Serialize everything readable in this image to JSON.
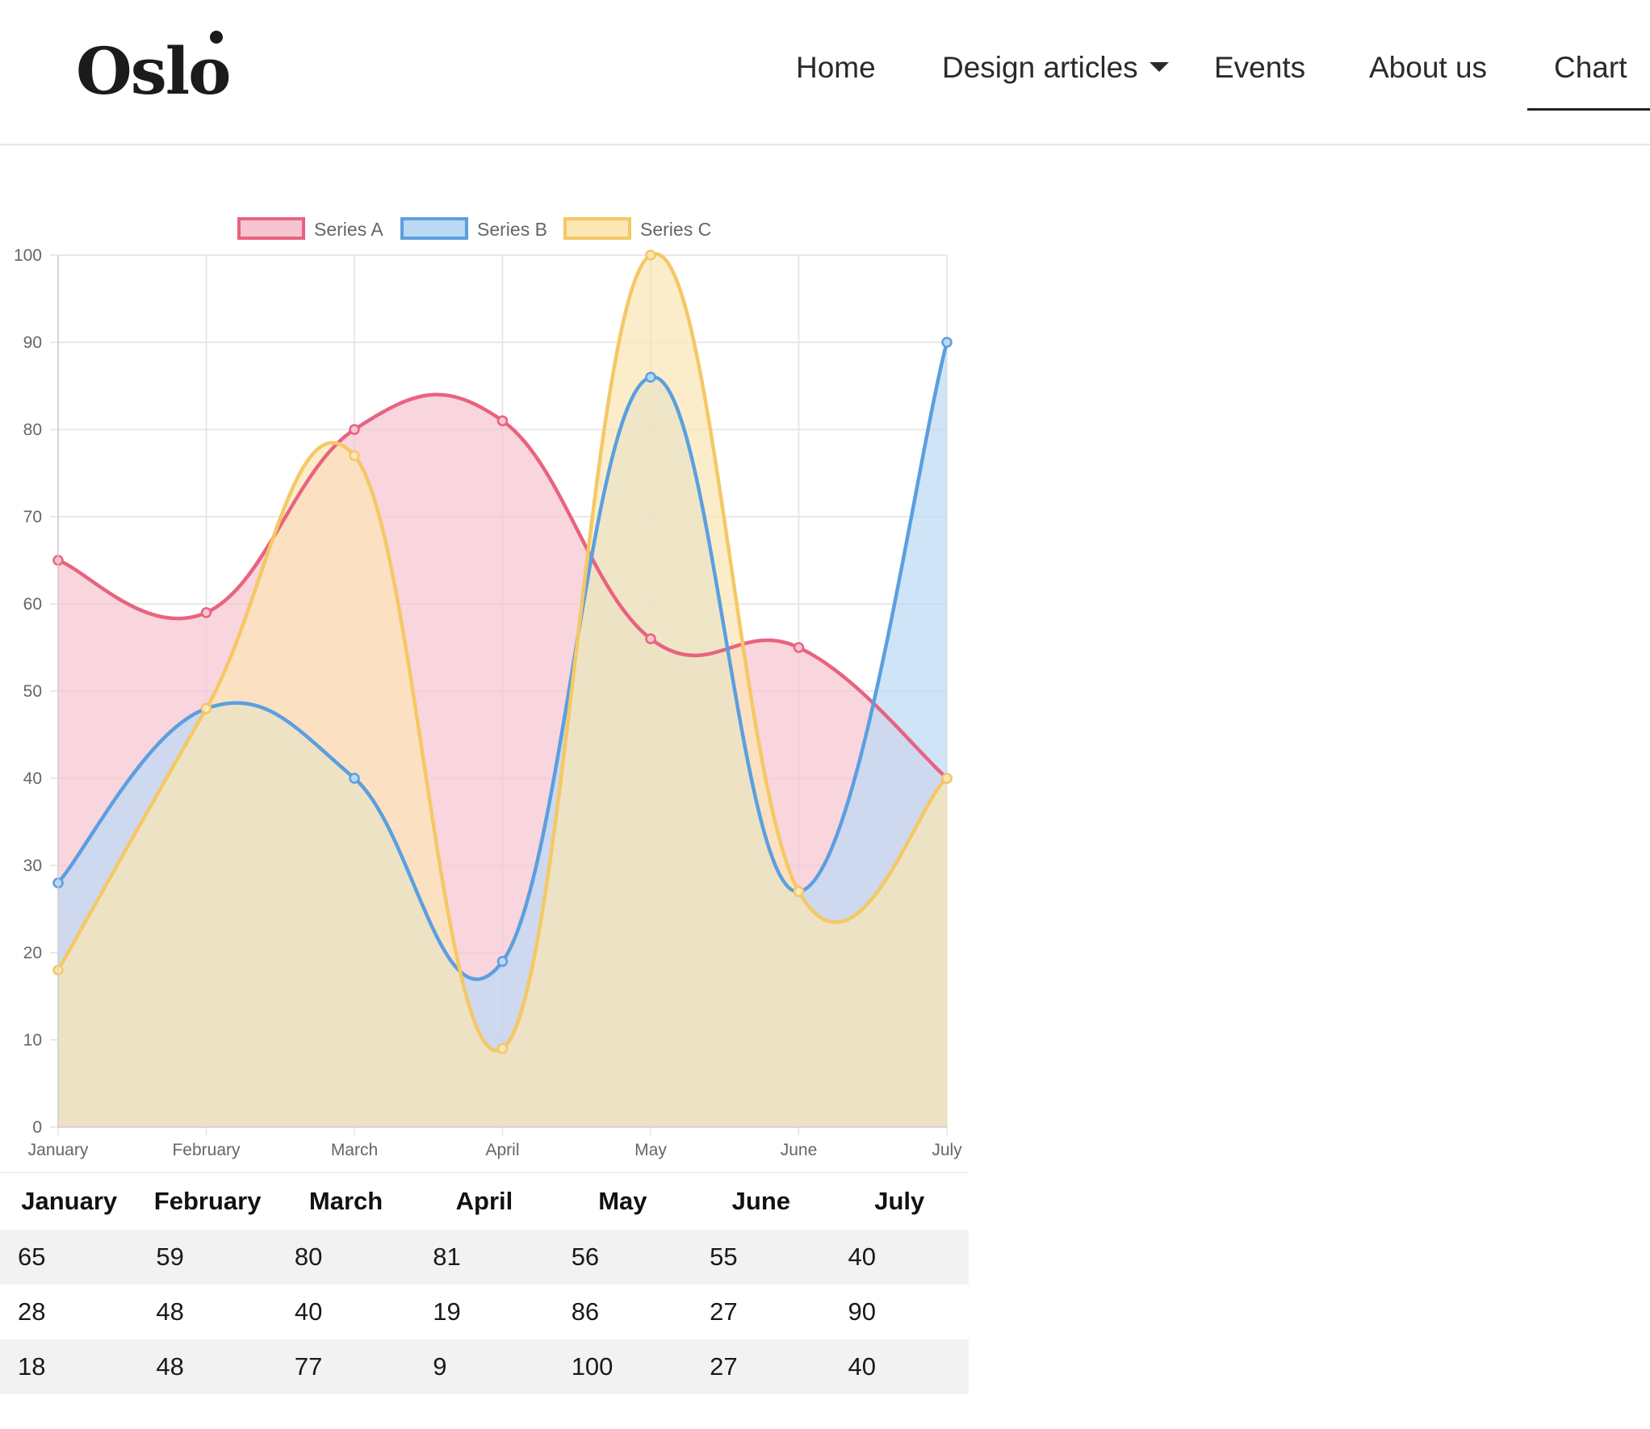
{
  "header": {
    "logo": "Oslo",
    "nav": [
      {
        "label": "Home",
        "active": false
      },
      {
        "label": "Design articles",
        "active": false,
        "has_dropdown": true
      },
      {
        "label": "Events",
        "active": false
      },
      {
        "label": "About us",
        "active": false
      },
      {
        "label": "Chart",
        "active": true
      }
    ]
  },
  "chart_data": {
    "type": "area",
    "categories": [
      "January",
      "February",
      "March",
      "April",
      "May",
      "June",
      "July"
    ],
    "series": [
      {
        "name": "Series A",
        "values": [
          65,
          59,
          80,
          81,
          56,
          55,
          40
        ],
        "color": "#e8637f",
        "fill": "#f7c5d0"
      },
      {
        "name": "Series B",
        "values": [
          28,
          48,
          40,
          19,
          86,
          27,
          90
        ],
        "color": "#5b9fe0",
        "fill": "#bcd9f4"
      },
      {
        "name": "Series C",
        "values": [
          18,
          48,
          77,
          9,
          100,
          27,
          40
        ],
        "color": "#f4c865",
        "fill": "#fbe6b5"
      }
    ],
    "ylim": [
      0,
      100
    ],
    "yticks": [
      0,
      10,
      20,
      30,
      40,
      50,
      60,
      70,
      80,
      90,
      100
    ],
    "grid": true,
    "legend_position": "top",
    "curve": "smooth"
  },
  "table": {
    "headers": [
      "January",
      "February",
      "March",
      "April",
      "May",
      "June",
      "July"
    ],
    "rows": [
      [
        "65",
        "59",
        "80",
        "81",
        "56",
        "55",
        "40"
      ],
      [
        "28",
        "48",
        "40",
        "19",
        "86",
        "27",
        "90"
      ],
      [
        "18",
        "48",
        "77",
        "9",
        "100",
        "27",
        "40"
      ]
    ]
  }
}
